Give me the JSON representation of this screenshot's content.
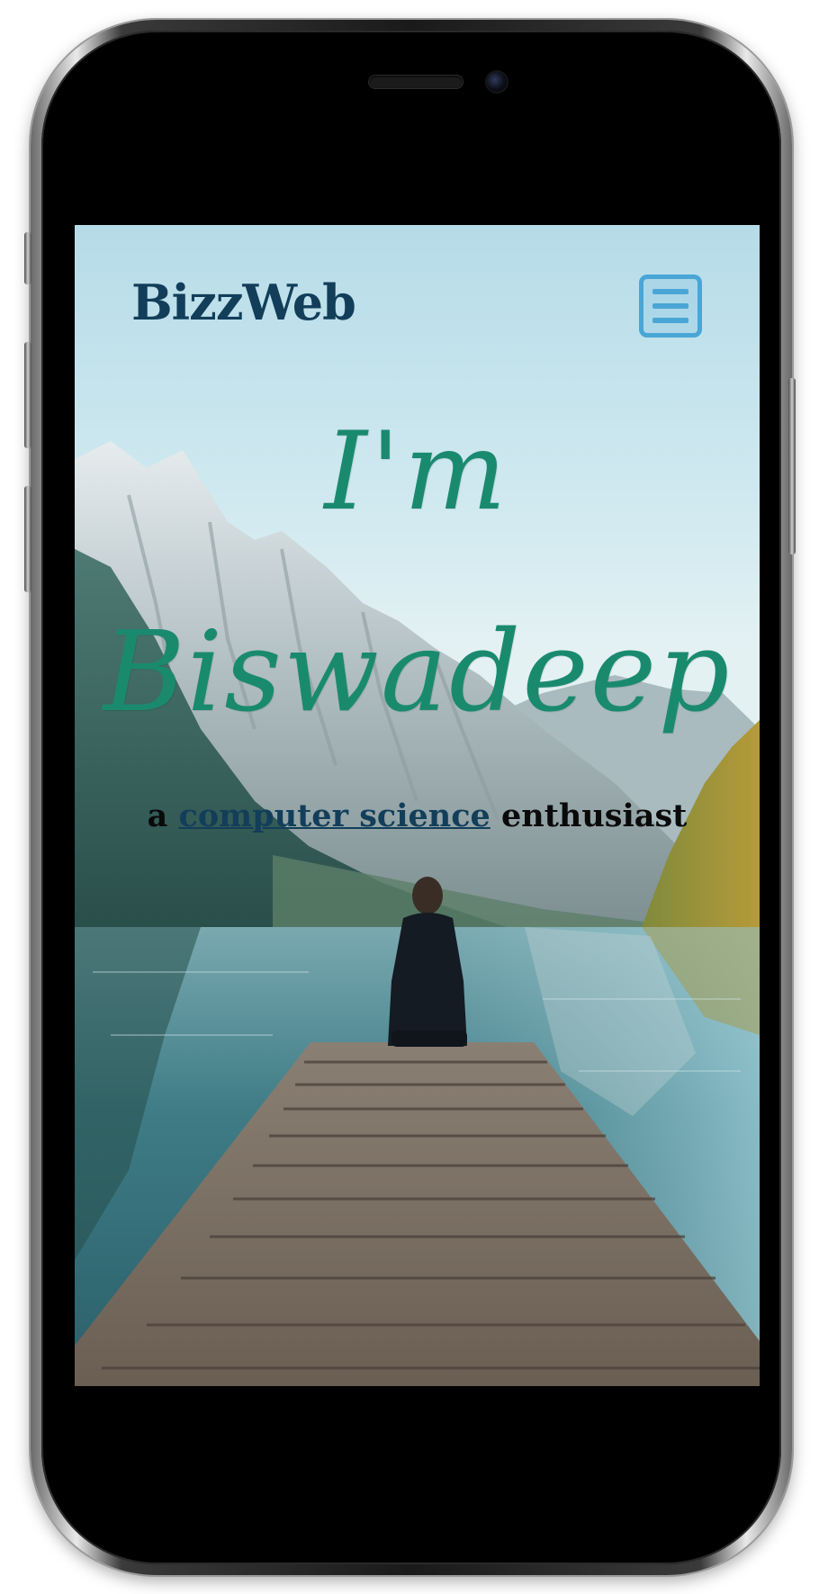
{
  "header": {
    "brand": "BizzWeb",
    "menu_icon": "hamburger-menu-icon"
  },
  "hero": {
    "line1": "I'm",
    "line2": "Biswadeep",
    "tagline_prefix": "a",
    "tagline_link": "computer science",
    "tagline_suffix": "enthusiast"
  },
  "colors": {
    "brand": "#123e5a",
    "accent": "#1a8a6f",
    "menu": "#4aa6d6",
    "sky": "#bfe0ea"
  },
  "background": {
    "image": "mountain-lake-dock-scene"
  }
}
